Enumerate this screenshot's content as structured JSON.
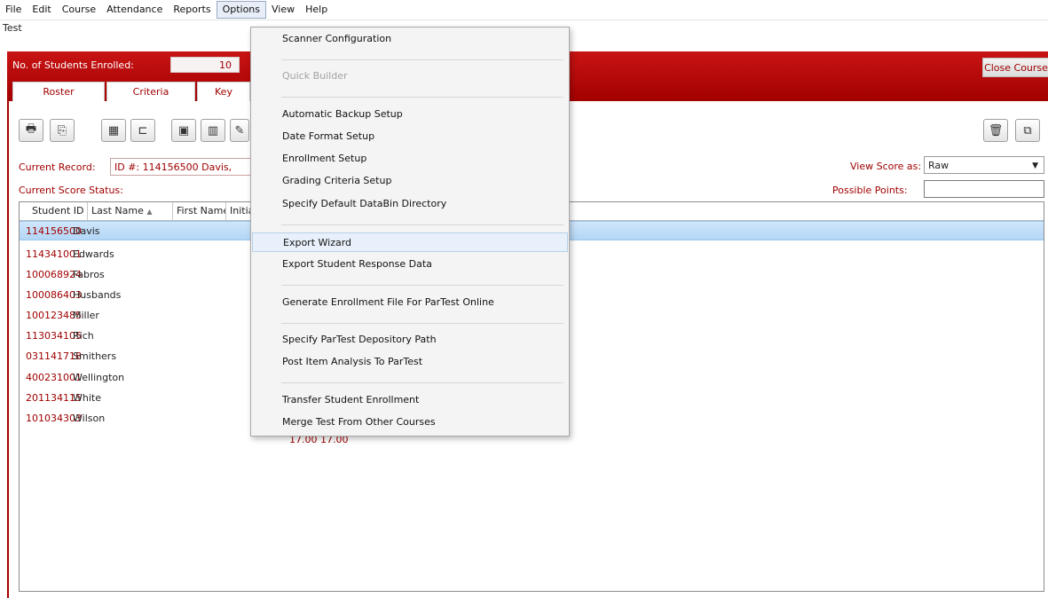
{
  "menubar": {
    "items": [
      "File",
      "Edit",
      "Course",
      "Attendance",
      "Reports",
      "Options",
      "View",
      "Help"
    ]
  },
  "document": {
    "title": "Test"
  },
  "header": {
    "enrolled_label": "No. of Students Enrolled:",
    "enrolled_value": "10",
    "close_course_label": "Close Course",
    "tabs": [
      "Roster",
      "Criteria",
      "Key"
    ]
  },
  "toolbar": {
    "icons": [
      "printer-icon",
      "export-icon",
      "scan-icon",
      "crop-icon",
      "calendar-icon",
      "columns-icon",
      "edit-icon"
    ],
    "right_icons": [
      "trash-icon",
      "copy-icon"
    ]
  },
  "record": {
    "current_label": "Current Record:",
    "current_value": "ID #: 114156500 Davis,",
    "status_label": "Current Score Status:",
    "view_score_label": "View Score as:",
    "view_score_value": "Raw",
    "possible_points_label": "Possible Points:",
    "possible_points_value": ""
  },
  "grid": {
    "columns": [
      "Student ID",
      "Last Name",
      "First Name",
      "Initia"
    ],
    "sort_indicator": "▲",
    "rows": [
      {
        "id": "114156500",
        "last": "Davis"
      },
      {
        "id": "114341001",
        "last": "Edwards"
      },
      {
        "id": "100068924",
        "last": "Fabros"
      },
      {
        "id": "100086403",
        "last": "Husbands"
      },
      {
        "id": "100123485",
        "last": "Miller"
      },
      {
        "id": "113034105",
        "last": "Rich"
      },
      {
        "id": "031141718",
        "last": "Smithers"
      },
      {
        "id": "400231001",
        "last": "Wellington"
      },
      {
        "id": "201134115",
        "last": "White"
      },
      {
        "id": "101034303",
        "last": "Wilson"
      }
    ],
    "partial_text": "17.00    17.00"
  },
  "options_menu": {
    "items": [
      {
        "label": "Scanner Configuration",
        "enabled": true
      },
      {
        "label": "Quick Builder",
        "enabled": false
      },
      {
        "label": "Automatic Backup Setup",
        "enabled": true
      },
      {
        "label": "Date Format Setup",
        "enabled": true
      },
      {
        "label": "Enrollment Setup",
        "enabled": true
      },
      {
        "label": "Grading Criteria Setup",
        "enabled": true
      },
      {
        "label": "Specify Default DataBin Directory",
        "enabled": true
      },
      {
        "label": "Export Wizard",
        "enabled": true,
        "hover": true
      },
      {
        "label": "Export Student Response Data",
        "enabled": true
      },
      {
        "label": "Generate Enrollment File For ParTest Online",
        "enabled": true
      },
      {
        "label": "Specify ParTest Depository Path",
        "enabled": true
      },
      {
        "label": "Post Item Analysis To ParTest",
        "enabled": true
      },
      {
        "label": "Transfer Student Enrollment",
        "enabled": true
      },
      {
        "label": "Merge Test From Other Courses",
        "enabled": true
      }
    ]
  },
  "colors": {
    "accent_red": "#a00000",
    "band_red": "#c81414",
    "selection_blue": "#cfe6fb"
  }
}
